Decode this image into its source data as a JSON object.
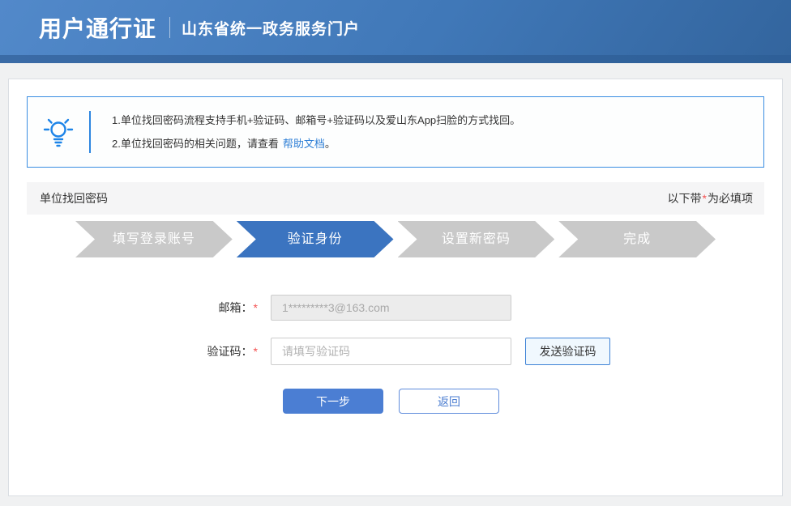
{
  "header": {
    "brand": "用户通行证",
    "portal": "山东省统一政务服务门户"
  },
  "tips": {
    "line1": "1.单位找回密码流程支持手机+验证码、邮箱号+验证码以及爱山东App扫脸的方式找回。",
    "line2_prefix": "2.单位找回密码的相关问题，请查看",
    "line2_link": "帮助文档",
    "line2_suffix": "。"
  },
  "section": {
    "title": "单位找回密码",
    "required_prefix": "以下带",
    "required_star": "*",
    "required_suffix": "为必填项"
  },
  "steps": [
    {
      "label": "填写登录账号",
      "active": false
    },
    {
      "label": "验证身份",
      "active": true
    },
    {
      "label": "设置新密码",
      "active": false
    },
    {
      "label": "完成",
      "active": false
    }
  ],
  "form": {
    "email": {
      "label": "邮箱：",
      "required": "*",
      "value": "1*********3@163.com"
    },
    "code": {
      "label": "验证码：",
      "required": "*",
      "placeholder": "请填写验证码",
      "send_button": "发送验证码"
    },
    "next_button": "下一步",
    "back_button": "返回"
  },
  "colors": {
    "header_gradient_start": "#5289ca",
    "header_gradient_end": "#33659e",
    "tip_border": "#3a8de2",
    "bulb_blue": "#1d84e8",
    "link_blue": "#2e7fd6",
    "step_active": "#3b74c0",
    "step_inactive": "#c9c9c9",
    "primary_button": "#4b7ed3",
    "required_red": "#f45151"
  }
}
